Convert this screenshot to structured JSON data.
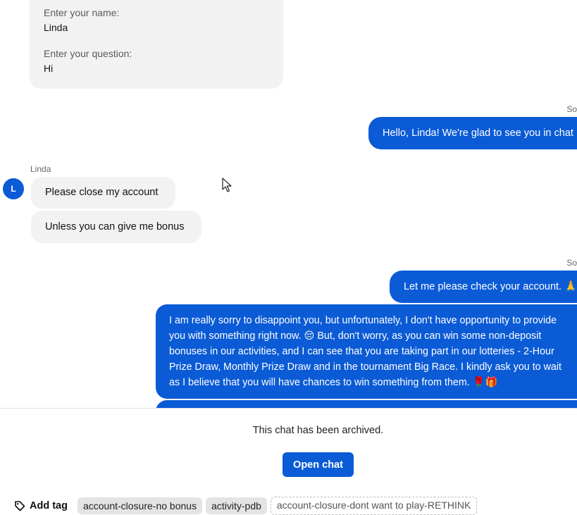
{
  "form": {
    "name_label": "Enter your name:",
    "name_value": "Linda",
    "question_label": "Enter your question:",
    "question_value": "Hi"
  },
  "messages": {
    "agent_sender_1": "So",
    "greeting": "Hello, Linda! We're glad to see you in chat",
    "customer_name": "Linda",
    "customer_avatar_initial": "L",
    "customer_msg_1": "Please close my account",
    "customer_msg_2": "Unless you can give me bonus",
    "agent_sender_2": "So",
    "check_account": "Let me please check your account. 🙏",
    "long_reply_lines": [
      "I am really sorry to disappoint you, but unfortunately, I don't have opportunity to provide",
      "you with something right now. 😔 But, don't worry, as you can win some non-deposit",
      "bonuses in our activities, and I can see that you are taking part in our lotteries - 2-Hour",
      "Prize Draw, Monthly Prize Draw and in the tournament Big Race. I kindly ask you to wait",
      "as I believe that you will have chances to win something from them. 🌹🎁"
    ]
  },
  "footer": {
    "archived_text": "This chat has been archived.",
    "open_chat_label": "Open chat",
    "add_tag_label": "Add tag",
    "tags": [
      "account-closure-no bonus",
      "activity-pdb"
    ],
    "suggested_tag": "account-closure-dont want to play-RETHINK"
  },
  "colors": {
    "accent": "#0b5bd6",
    "bubble_gray": "#f2f2f2"
  },
  "icons": {
    "tag_icon": "tag-icon",
    "cursor": "mouse-pointer-icon"
  }
}
